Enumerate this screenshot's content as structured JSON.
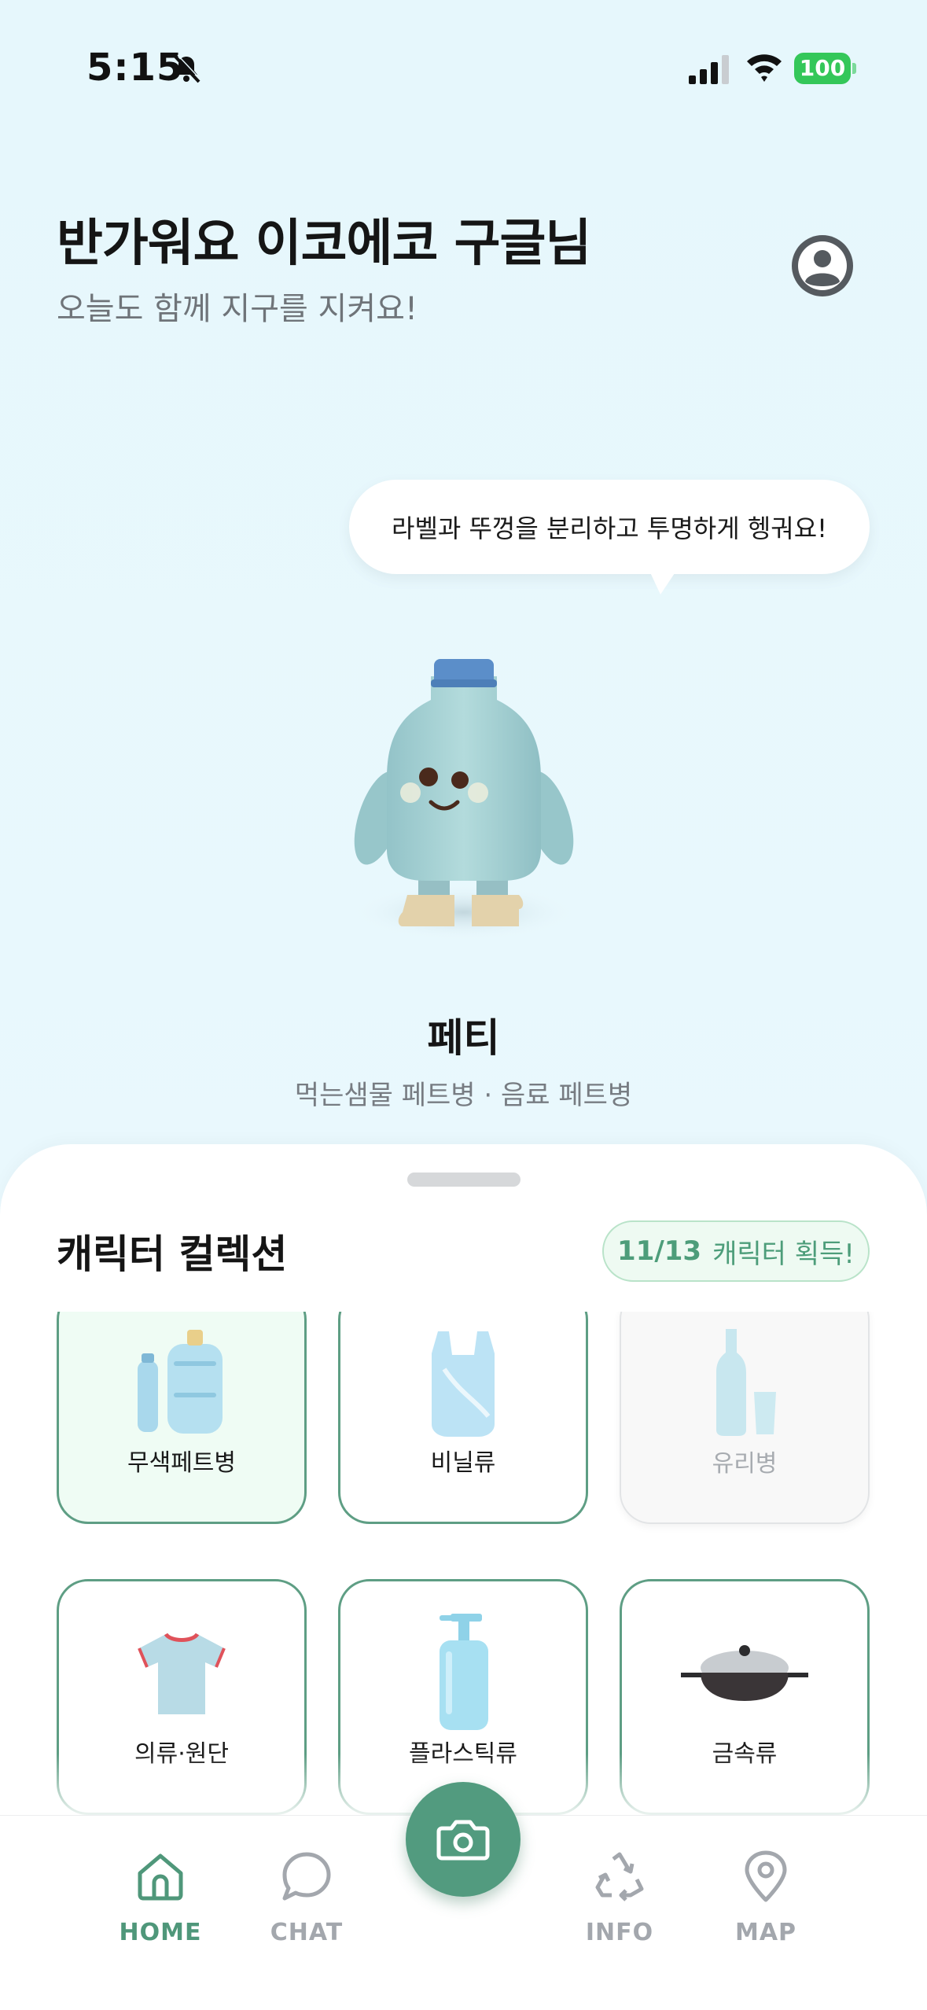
{
  "status_bar": {
    "time": "5:15",
    "battery": "100",
    "icons": [
      "bell-slash-icon",
      "cellular-signal-icon",
      "wifi-icon",
      "battery-icon"
    ]
  },
  "header": {
    "greeting": "반가워요 이코에코 구글님",
    "subtitle": "오늘도 함께 지구를 지켜요!",
    "profile_icon": "user-circle-icon"
  },
  "character": {
    "speech": "라벨과 뚜껑을 분리하고 투명하게 헹궈요!",
    "name": "페티",
    "description": "먹는샘물 페트병 · 음료 페트병"
  },
  "collection": {
    "title": "캐릭터 컬렉션",
    "badge_count": "11/13",
    "badge_text": "캐릭터 획득!",
    "items": [
      {
        "label": "무색페트병",
        "icon": "pet-bottles-icon",
        "state": "selected"
      },
      {
        "label": "비닐류",
        "icon": "plastic-bag-icon",
        "state": "unlocked"
      },
      {
        "label": "유리병",
        "icon": "glass-bottle-icon",
        "state": "locked"
      },
      {
        "label": "의류·원단",
        "icon": "tshirt-icon",
        "state": "unlocked"
      },
      {
        "label": "플라스틱류",
        "icon": "pump-bottle-icon",
        "state": "unlocked"
      },
      {
        "label": "금속류",
        "icon": "frying-pan-icon",
        "state": "unlocked"
      }
    ]
  },
  "nav": {
    "home": "HOME",
    "chat": "CHAT",
    "info": "INFO",
    "map": "MAP",
    "active": "HOME",
    "camera_icon": "camera-icon"
  },
  "colors": {
    "background": "#e9f8fd",
    "accent": "#529b7f",
    "card_border": "#5e9e84",
    "badge_bg": "#eefaf2",
    "nav_inactive": "#a3a7ad"
  }
}
